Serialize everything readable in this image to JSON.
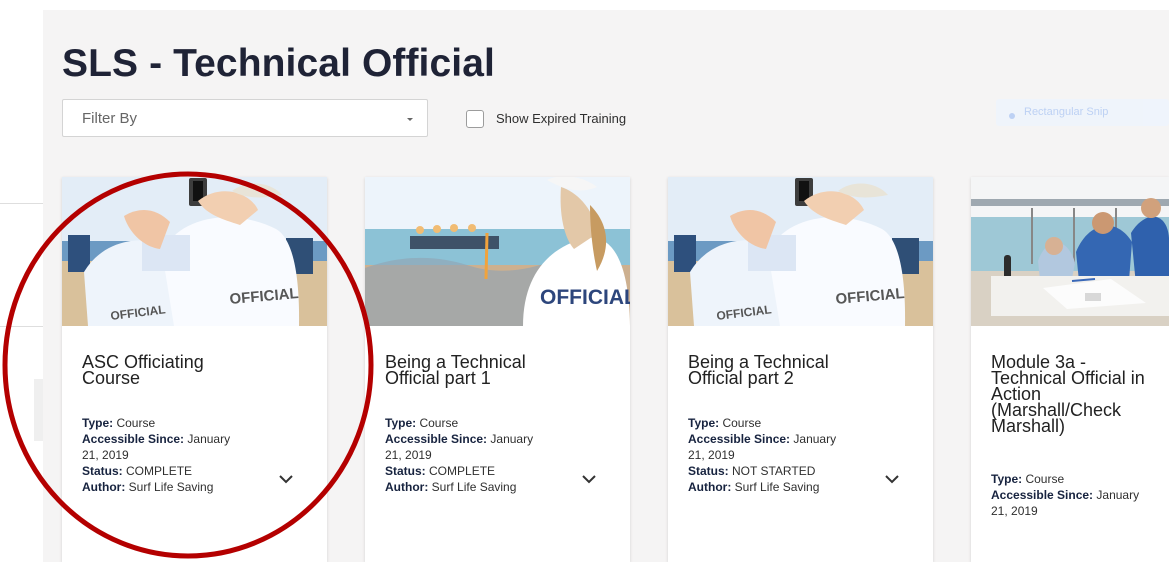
{
  "page": {
    "title": "SLS - Technical Official"
  },
  "filters": {
    "filter_label": "Filter By",
    "show_expired_label": "Show Expired Training",
    "hidden_control_label": "Rectangular Snip"
  },
  "colors": {
    "title_text": "#1f2336",
    "annotation_circle": "#b40000",
    "card_background": "#ffffff",
    "workspace_background": "#f5f4f4"
  },
  "icons": {
    "dropdown": "chevron-down-icon",
    "expand": "chevron-down-icon",
    "checkbox": "checkbox-icon"
  },
  "cards": [
    {
      "title": "ASC Officiating\nCourse",
      "type_key": "Type:",
      "type_value": "Course",
      "accessible_key": "Accessible Since:",
      "accessible_value": "January\n21, 2019",
      "status_key": "Status:",
      "status_value": "COMPLETE",
      "author_key": "Author:",
      "author_value": "Surf Life Saving"
    },
    {
      "title": "Being a Technical\nOfficial part 1",
      "type_key": "Type:",
      "type_value": "Course",
      "accessible_key": "Accessible Since:",
      "accessible_value": "January\n21, 2019",
      "status_key": "Status:",
      "status_value": "COMPLETE",
      "author_key": "Author:",
      "author_value": "Surf Life Saving"
    },
    {
      "title": "Being a Technical\nOfficial part 2",
      "type_key": "Type:",
      "type_value": "Course",
      "accessible_key": "Accessible Since:",
      "accessible_value": "January\n21, 2019",
      "status_key": "Status:",
      "status_value": "NOT STARTED",
      "author_key": "Author:",
      "author_value": "Surf Life Saving"
    },
    {
      "title": "Module 3a -\nTechnical Official in\nAction\n(Marshall/Check\nMarshall)",
      "type_key": "Type:",
      "type_value": "Course",
      "accessible_key": "Accessible Since:",
      "accessible_value": "January\n21, 2019"
    }
  ]
}
